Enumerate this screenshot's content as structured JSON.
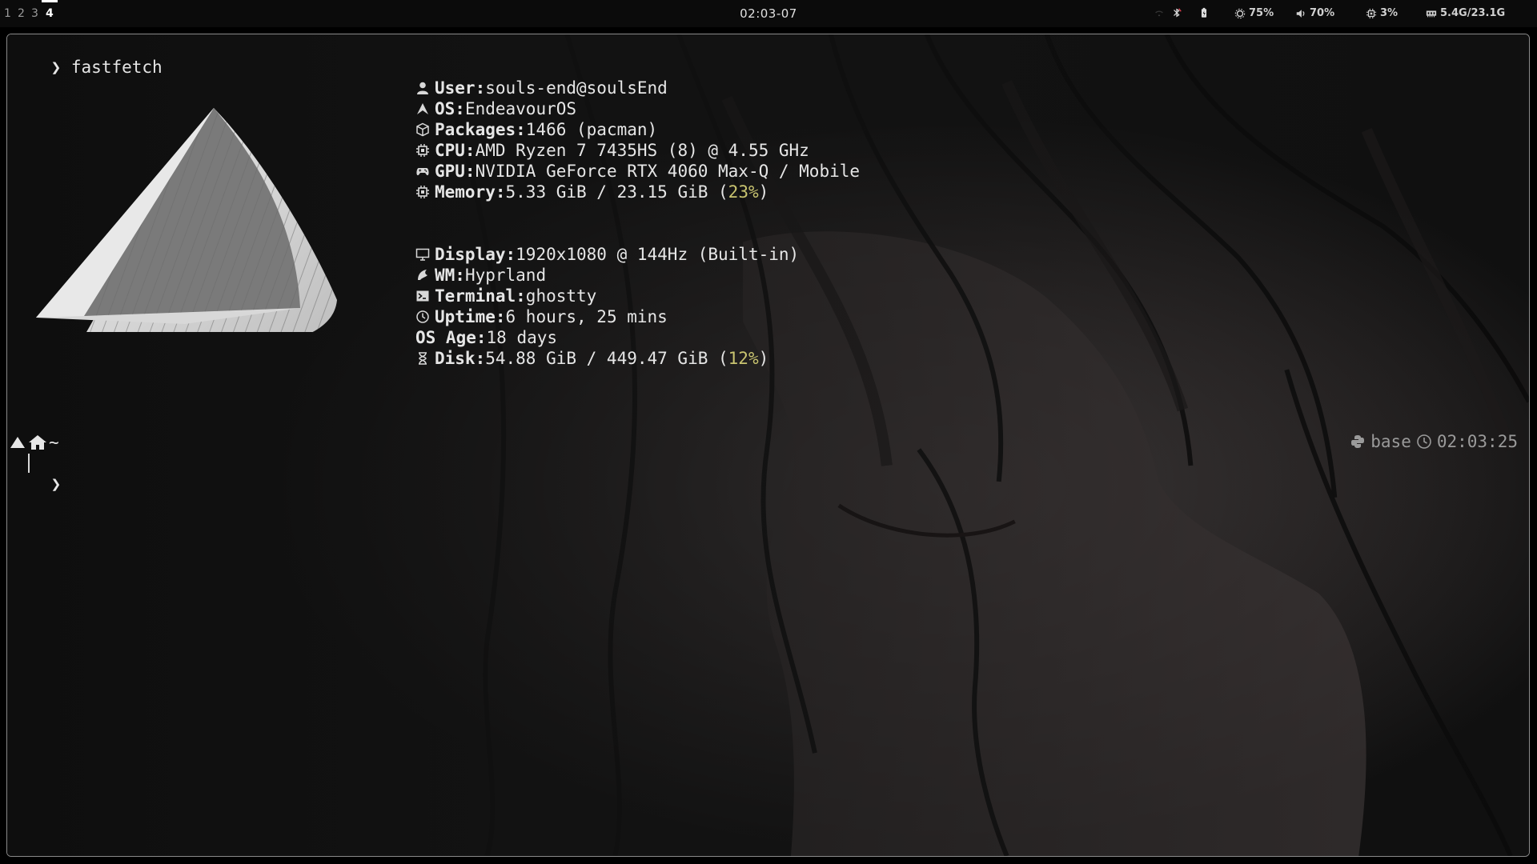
{
  "topbar": {
    "workspaces": [
      {
        "label": "1",
        "active": false
      },
      {
        "label": "2",
        "active": false
      },
      {
        "label": "3",
        "active": false
      },
      {
        "label": "4",
        "active": true
      }
    ],
    "clock": "02:03-07",
    "brightness": "75%",
    "volume": "70%",
    "cpu": "3%",
    "memory": "5.4G/23.1G",
    "icons": [
      "wifi-icon",
      "bluetooth-off-icon",
      "battery-icon",
      "brightness-icon",
      "volume-icon",
      "cpu-icon",
      "memory-icon"
    ]
  },
  "terminal": {
    "command_prompt": "❯",
    "command": "fastfetch",
    "info": [
      {
        "icon": "user-icon",
        "key": "User:",
        "value": "souls-end@soulsEnd"
      },
      {
        "icon": "os-icon",
        "key": "OS:",
        "value": "EndeavourOS"
      },
      {
        "icon": "package-icon",
        "key": "Packages:",
        "value": "1466 (pacman)"
      },
      {
        "icon": "cpu-icon",
        "key": "CPU:",
        "value": "AMD Ryzen 7 7435HS (8) @ 4.55 GHz"
      },
      {
        "icon": "gamepad-icon",
        "key": "GPU:",
        "value": "NVIDIA GeForce RTX 4060 Max-Q / Mobile"
      },
      {
        "icon": "memory-icon",
        "key": "Memory:",
        "value_prefix": "5.33 GiB / 23.15 GiB (",
        "value_accent": "23%",
        "value_suffix": ")"
      },
      {
        "icon": "monitor-icon",
        "key": "Display:",
        "value": "1920x1080 @ 144Hz (Built-in)"
      },
      {
        "icon": "wm-icon",
        "key": "WM:",
        "value": "Hyprland"
      },
      {
        "icon": "terminal-icon",
        "key": "Terminal:",
        "value": "ghostty"
      },
      {
        "icon": "clock-icon",
        "key": "Uptime:",
        "value": "6 hours, 25 mins"
      },
      {
        "icon": "",
        "key": "OS Age:",
        "value": "18 days"
      },
      {
        "icon": "hourglass-icon",
        "key": "Disk:",
        "value_prefix": "54.88 GiB / 449.47 GiB (",
        "value_accent": "12%",
        "value_suffix": ")"
      }
    ],
    "prompt_path": "~",
    "prompt_symbol": "❯",
    "right_prompt": {
      "env": "base",
      "time": "02:03:25"
    },
    "colors": {
      "accent": "#c9c470",
      "text": "#e6e6e6",
      "dim": "#9a9a9a"
    }
  }
}
